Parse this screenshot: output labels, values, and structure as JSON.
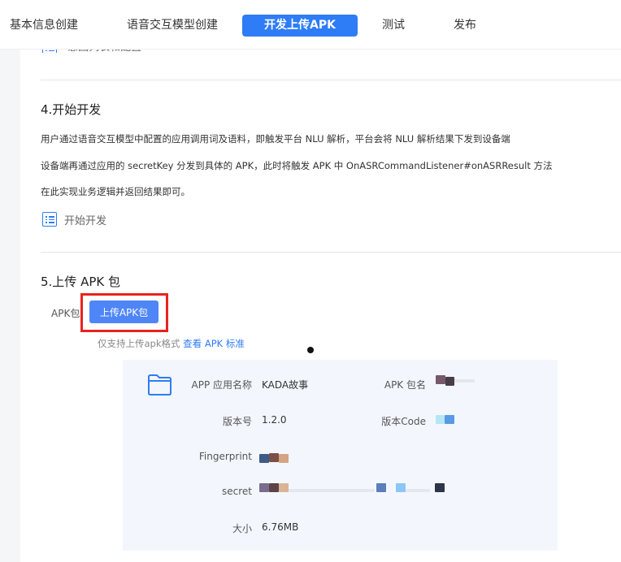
{
  "tabs": [
    {
      "label": "基本信息创建",
      "active": false
    },
    {
      "label": "语音交互模型创建",
      "active": false
    },
    {
      "label": "开发上传APK",
      "active": true
    },
    {
      "label": "测试",
      "active": false
    },
    {
      "label": "发布",
      "active": false
    }
  ],
  "previous_link": "意图列表和配置",
  "section4": {
    "title": "4.开始开发",
    "lines": [
      "用户通过语音交互模型中配置的应用调用词及语料，即触发平台 NLU 解析，平台会将 NLU 解析结果下发到设备端",
      "设备端再通过应用的 secretKey 分发到具体的 APK，此时将触发 APK 中 OnASRCommandListener#onASRResult 方法",
      "在此实现业务逻辑并返回结果即可。"
    ],
    "link_label": "开始开发"
  },
  "section5": {
    "title": "5.上传 APK 包",
    "apk_label": "APK包",
    "upload_button": "上传APK包",
    "hint_prefix": "仅支持上传apk格式",
    "hint_link": "查看 APK 标准"
  },
  "apk_info": {
    "app_name_label": "APP 应用名称",
    "app_name": "KADA故事",
    "package_label": "APK 包名",
    "version_label": "版本号",
    "version": "1.2.0",
    "version_code_label": "版本Code",
    "fingerprint_label": "Fingerprint",
    "secret_label": "secret",
    "size_label": "大小",
    "size": "6.76MB"
  },
  "colors": {
    "primary": "#2e7cf6",
    "button": "#4f86f7",
    "highlight": "#e8231e",
    "card_bg": "#f3f7fd"
  },
  "icons": [
    "list-icon",
    "folder-icon"
  ]
}
